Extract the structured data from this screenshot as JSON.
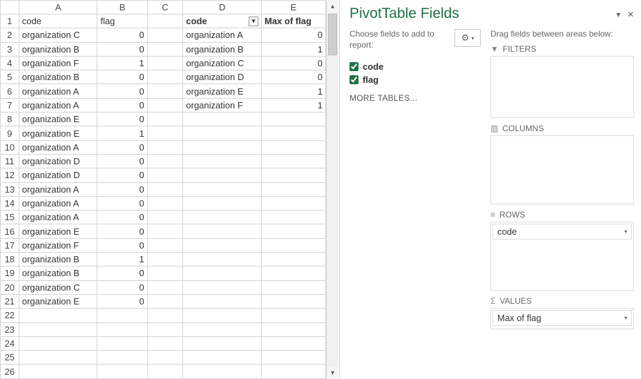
{
  "columns": [
    "A",
    "B",
    "C",
    "D",
    "E"
  ],
  "headerRow": {
    "A": "code",
    "B": "flag"
  },
  "dataRows": [
    [
      "organization C",
      0
    ],
    [
      "organization B",
      0
    ],
    [
      "organization F",
      1
    ],
    [
      "organization B",
      0
    ],
    [
      "organization A",
      0
    ],
    [
      "organization A",
      0
    ],
    [
      "organization E",
      0
    ],
    [
      "organization E",
      1
    ],
    [
      "organization A",
      0
    ],
    [
      "organization D",
      0
    ],
    [
      "organization D",
      0
    ],
    [
      "organization A",
      0
    ],
    [
      "organization A",
      0
    ],
    [
      "organization A",
      0
    ],
    [
      "organization E",
      0
    ],
    [
      "organization F",
      0
    ],
    [
      "organization B",
      1
    ],
    [
      "organization B",
      0
    ],
    [
      "organization C",
      0
    ],
    [
      "organization E",
      0
    ]
  ],
  "pivot": {
    "header": {
      "code": "code",
      "value": "Max of flag"
    },
    "rows": [
      [
        "organization A",
        0
      ],
      [
        "organization B",
        1
      ],
      [
        "organization C",
        0
      ],
      [
        "organization D",
        0
      ],
      [
        "organization E",
        1
      ],
      [
        "organization F",
        1
      ]
    ]
  },
  "totalRows": 26,
  "pane": {
    "title": "PivotTable Fields",
    "choose": "Choose fields to add to report:",
    "fields": [
      {
        "name": "code",
        "checked": true
      },
      {
        "name": "flag",
        "checked": true
      }
    ],
    "more": "MORE TABLES...",
    "drag": "Drag fields between areas below:",
    "areas": {
      "filters": {
        "label": "FILTERS",
        "items": []
      },
      "columns": {
        "label": "COLUMNS",
        "items": []
      },
      "rows": {
        "label": "ROWS",
        "items": [
          "code"
        ]
      },
      "values": {
        "label": "VALUES",
        "items": [
          "Max of flag"
        ]
      }
    }
  }
}
